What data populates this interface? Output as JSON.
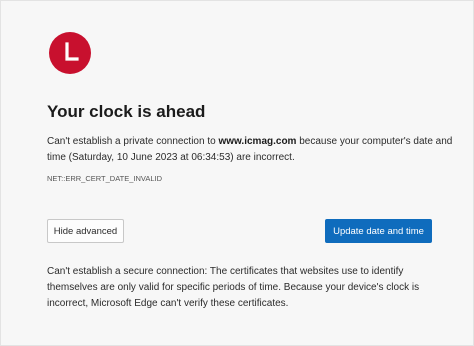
{
  "icon": {
    "name": "clock-icon",
    "color": "#c8102e"
  },
  "heading": "Your clock is ahead",
  "description": {
    "prefix": "Can't establish a private connection to ",
    "host": "www.icmag.com",
    "suffix": " because your computer's date and time (Saturday, 10 June 2023 at 06:34:53) are incorrect."
  },
  "error_code": "NET::ERR_CERT_DATE_INVALID",
  "buttons": {
    "hide_advanced": "Hide advanced",
    "update_date_time": "Update date and time"
  },
  "advanced_text": "Can't establish a secure connection: The certificates that websites use to identify themselves are only valid for specific periods of time. Because your device's clock is incorrect, Microsoft Edge can't verify these certificates.",
  "colors": {
    "accent": "#0f6cbd",
    "icon_red": "#c8102e"
  }
}
